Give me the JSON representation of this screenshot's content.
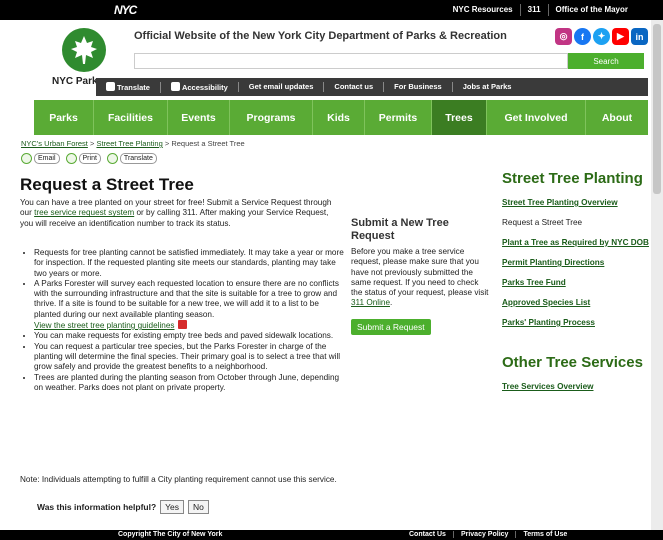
{
  "topbar": {
    "logo": "NYC",
    "links": [
      "NYC Resources",
      "311",
      "Office of the Mayor"
    ]
  },
  "header": {
    "site_title": "Official Website of the New York City Department of Parks & Recreation",
    "logo_text": "NYC Parks",
    "search_placeholder": "",
    "search_button": "Search",
    "social_icons": [
      "instagram-icon",
      "facebook-icon",
      "twitter-icon",
      "youtube-icon",
      "linkedin-icon"
    ],
    "social_colors": [
      "#c13584",
      "#1877f2",
      "#1da1f2",
      "#ff0000",
      "#0a66c2"
    ]
  },
  "utility_nav": {
    "items": [
      "Translate",
      "Accessibility",
      "Get email updates",
      "Contact us",
      "For Business",
      "Jobs at Parks"
    ]
  },
  "main_nav": {
    "items": [
      "Parks",
      "Facilities",
      "Events",
      "Programs",
      "Kids",
      "Permits",
      "Trees",
      "Get Involved",
      "About"
    ],
    "active": "Trees"
  },
  "breadcrumb": {
    "items": [
      "NYC's Urban Forest",
      "Street Tree Planting"
    ],
    "current": "Request a Street Tree",
    "separator": ">"
  },
  "share": {
    "email": "Email",
    "print": "Print",
    "translate": "Translate"
  },
  "main": {
    "title": "Request a Street Tree",
    "intro_1": "You can have a tree planted on your street for free! Submit a Service Request through our ",
    "intro_link": "tree service request system",
    "intro_2": " or by calling 311. After making your Service Request, you will receive an identification number to track its status.",
    "bullets": [
      "Requests for tree planting cannot be satisfied immediately. It may take a year or more for inspection. If the requested planting site meets our standards, planting may take two years or more.",
      "A Parks Forester will survey each requested location to ensure there are no conflicts with the surrounding infrastructure and that the site is suitable for a tree to grow and thrive. If a site is found to be suitable for a new tree, we will add it to a list to be planted during our next available planting season.",
      "You can make requests for existing empty tree beds and paved sidewalk locations.",
      "You can request a particular tree species, but the Parks Forester in charge of the planting will determine the final species. Their primary goal is to select a tree that will grow safely and provide the greatest benefits to a neighborhood.",
      "Trees are planted during the planting season from October through June, depending on weather. Parks does not plant on private property."
    ],
    "guidelines_link": "View the street tree planting guidelines",
    "note": "Note: Individuals attempting to fulfill a City planting requirement cannot use this service."
  },
  "submit_box": {
    "title": "Submit a New Tree Request",
    "text_1": "Before you make a tree service request, please make sure that you have not previously submitted the same request. If you need to check the status of your request, please visit ",
    "link": "311 Online",
    "text_2": ".",
    "button": "Submit a Request"
  },
  "sidebar": {
    "title_1": "Street Tree Planting",
    "links_1": [
      {
        "label": "Street Tree Planting Overview",
        "current": false
      },
      {
        "label": "Request a Street Tree",
        "current": true
      },
      {
        "label": "Plant a Tree as Required by NYC DOB",
        "current": false
      },
      {
        "label": "Permit Planting Directions",
        "current": false
      },
      {
        "label": "Parks Tree Fund",
        "current": false
      },
      {
        "label": "Approved Species List",
        "current": false
      },
      {
        "label": "Parks' Planting Process",
        "current": false
      }
    ],
    "title_2": "Other Tree Services",
    "links_2": [
      {
        "label": "Tree Services Overview",
        "current": false
      }
    ]
  },
  "feedback": {
    "question": "Was this information helpful?",
    "yes": "Yes",
    "no": "No"
  },
  "footer": {
    "copyright": "Copyright The City of New York",
    "links": [
      "Contact Us",
      "Privacy Policy",
      "Terms of Use"
    ]
  }
}
